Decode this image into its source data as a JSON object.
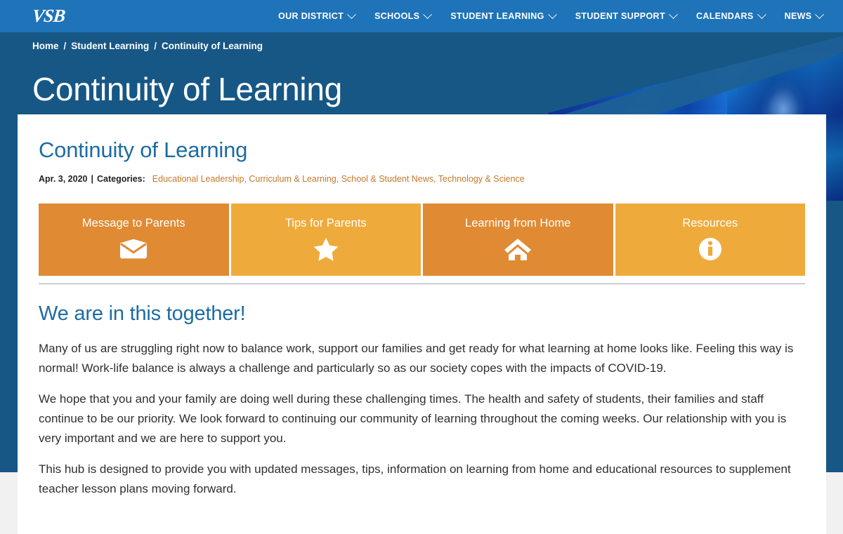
{
  "site": {
    "logo_text": "VSB",
    "logo_name": "vsb-logo"
  },
  "topnav": {
    "items": [
      {
        "label": "OUR DISTRICT",
        "has_dropdown": true
      },
      {
        "label": "SCHOOLS",
        "has_dropdown": true
      },
      {
        "label": "STUDENT LEARNING",
        "has_dropdown": true
      },
      {
        "label": "STUDENT SUPPORT",
        "has_dropdown": true
      },
      {
        "label": "CALENDARS",
        "has_dropdown": true
      },
      {
        "label": "NEWS",
        "has_dropdown": true
      }
    ]
  },
  "breadcrumb": {
    "separator": "/",
    "items": [
      {
        "label": "Home"
      },
      {
        "label": "Student Learning"
      },
      {
        "label": "Continuity of Learning"
      }
    ]
  },
  "hero": {
    "title": "Continuity of Learning"
  },
  "article": {
    "title": "Continuity of Learning",
    "date": "Apr. 3, 2020",
    "separator": "|",
    "categories_label": "Categories:",
    "categories": [
      "Educational Leadership",
      "Curriculum & Learning",
      "School & Student News",
      "Technology & Science"
    ],
    "categories_text": "Educational Leadership, Curriculum & Learning, School & Student News, Technology & Science"
  },
  "tiles": [
    {
      "label": "Message to Parents",
      "icon": "envelope-icon",
      "color": "#e08a33"
    },
    {
      "label": "Tips for Parents",
      "icon": "star-icon",
      "color": "#eeab3c"
    },
    {
      "label": "Learning from Home",
      "icon": "home-icon",
      "color": "#e08a33"
    },
    {
      "label": "Resources",
      "icon": "info-circle-icon",
      "color": "#eeab3c"
    }
  ],
  "content": {
    "heading": "We are in this together!",
    "paragraphs": [
      "Many of us are struggling right now to balance work, support our families and get ready for what learning at home looks like. Feeling this way is normal! Work-life balance is always a challenge and particularly so as our society copes with the impacts of COVID-19.",
      "We hope that you and your family are doing well during these challenging times. The health and safety of students, their families and staff continue to be our priority. We look forward to continuing our community of learning throughout the coming weeks. Our relationship with you is very important and we are here to support you.",
      "This hub is designed to provide you with updated messages, tips, information on learning from home and educational resources to supplement teacher lesson plans moving forward."
    ]
  },
  "colors": {
    "nav_blue": "#1f73b8",
    "hero_blue": "#175785",
    "heading_blue": "#1d6ba3",
    "tile_orange_dark": "#e08a33",
    "tile_orange_light": "#eeab3c",
    "category_link": "#c4782a",
    "page_bg": "#f1f1f1"
  }
}
